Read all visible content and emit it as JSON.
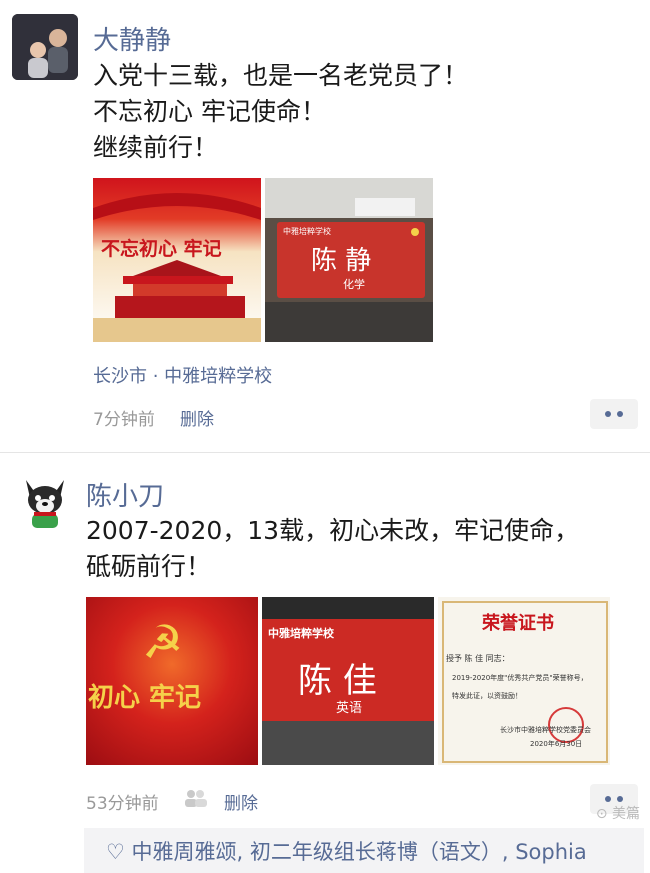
{
  "posts": [
    {
      "name": "大静静",
      "lines": [
        "入党十三载，也是一名老党员了！",
        "不忘初心  牢记使命！",
        "继续前行！"
      ],
      "images": [
        {
          "caption": "不忘初心  牢记"
        },
        {
          "header": "中雅培粹学校",
          "name": "陈  静",
          "subject": "化学"
        }
      ],
      "location": "长沙市 · 中雅培粹学校",
      "time": "7分钟前",
      "delete": "删除"
    },
    {
      "name": "陈小刀",
      "lines": [
        "2007-2020，13载，初心未改，牢记使命，",
        "砥砺前行！"
      ],
      "images": [
        {
          "caption": "初心  牢记"
        },
        {
          "header": "中雅培粹学校",
          "name": "陈  佳",
          "subject": "英语"
        },
        {
          "title": "荣誉证书",
          "line1": "授予 陈  佳 同志：",
          "line2": "2019-2020年度\"优秀共产党员\"荣誉称号，",
          "line3": "特发此证，以资鼓励！",
          "org": "长沙市中雅培粹学校党委员会",
          "date": "2020年6月30日"
        }
      ],
      "time": "53分钟前",
      "delete": "删除"
    }
  ],
  "likes": "♡ 中雅周雅颂, 初二年级组长蒋博（语文）, Sophia",
  "watermark": "⊙ 美篇",
  "colors": {
    "link": "#576b95",
    "party_red": "#c8161d"
  }
}
